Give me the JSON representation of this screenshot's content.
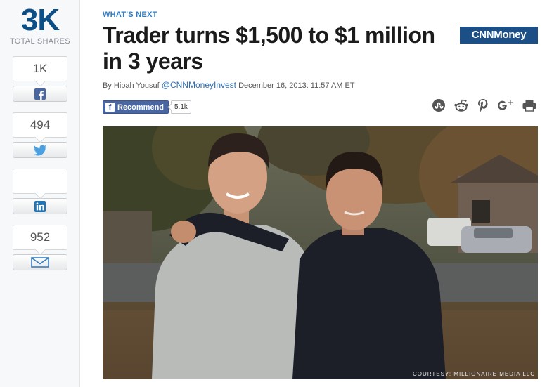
{
  "share_rail": {
    "total_count": "3K",
    "total_label": "TOTAL SHARES",
    "facebook": {
      "count": "1K",
      "icon": "facebook-icon"
    },
    "twitter": {
      "count": "494",
      "icon": "twitter-icon"
    },
    "linkedin": {
      "count": "",
      "icon": "linkedin-icon"
    },
    "email": {
      "count": "952",
      "icon": "envelope-icon"
    }
  },
  "article": {
    "kicker": "WHAT'S NEXT",
    "headline": "Trader turns $1,500 to $1 million in 3 years",
    "logo": "CNNMoney",
    "byline": {
      "author": "By Hibah Yousuf",
      "handle": "@CNNMoneyInvest",
      "date": "December 16, 2013: 11:57 AM ET"
    },
    "recommend": {
      "label": "Recommend",
      "count": "5.1k"
    },
    "tools": [
      "stumbleupon-icon",
      "reddit-icon",
      "pinterest-icon",
      "google-plus-icon",
      "print-icon"
    ],
    "photo": {
      "credit": "COURTESY: MILLIONAIRE MEDIA LLC"
    }
  },
  "colors": {
    "brand_blue": "#1c4f86",
    "kicker_blue": "#2e7cc4",
    "facebook_blue": "#4a66a0",
    "twitter_blue": "#4aa0e0",
    "linkedin_blue": "#1f75b5",
    "email_blue": "#3a7cc0"
  }
}
